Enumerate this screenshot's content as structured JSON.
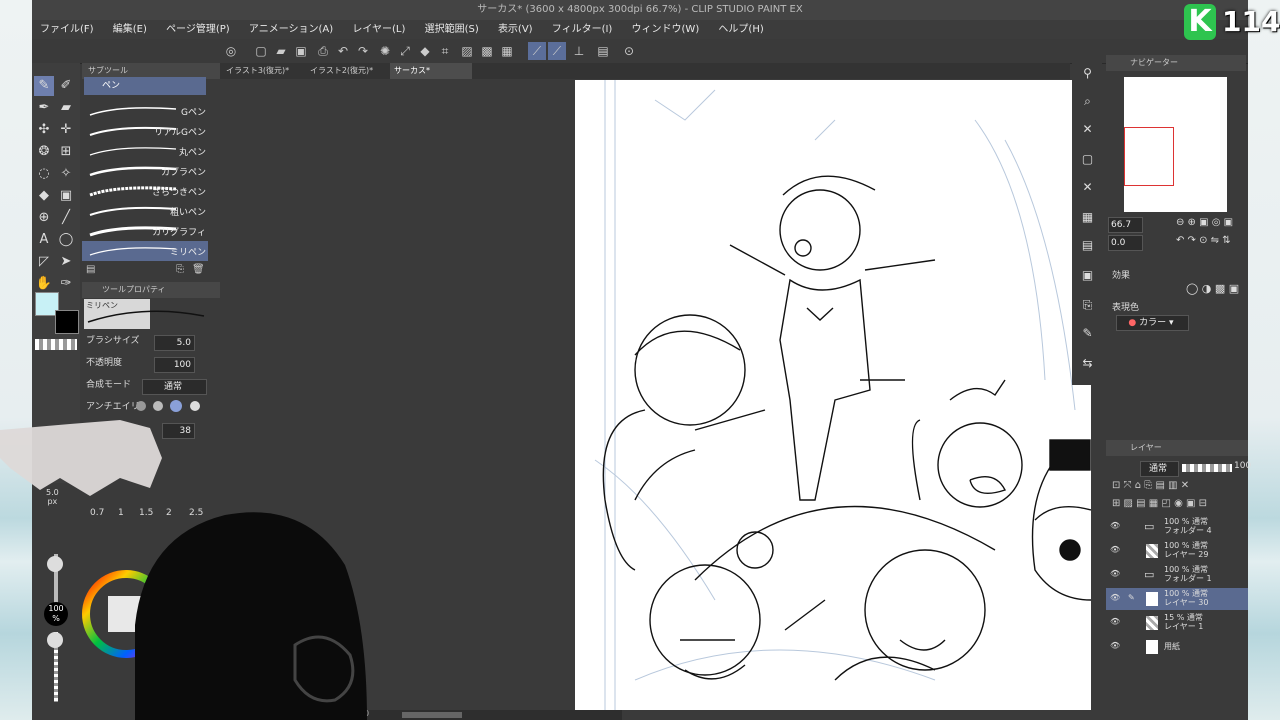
{
  "window": {
    "title": "サーカス* (3600 x 4800px 300dpi 66.7%)  - CLIP STUDIO PAINT EX"
  },
  "overlay": {
    "counter_letter": "K",
    "counter_value": "114"
  },
  "menu": [
    "ファイル(F)",
    "編集(E)",
    "ページ管理(P)",
    "アニメーション(A)",
    "レイヤー(L)",
    "選択範囲(S)",
    "表示(V)",
    "フィルター(I)",
    "ウィンドウ(W)",
    "ヘルプ(H)"
  ],
  "tabs": [
    {
      "label": "イラスト3(復元)*"
    },
    {
      "label": "イラスト2(復元)*"
    },
    {
      "label": "サーカス*"
    }
  ],
  "subtool": {
    "header": "サブツール",
    "group": "ペン",
    "brushes": [
      "Gペン",
      "リアルGペン",
      "丸ペン",
      "カブラペン",
      "ざらつきペン",
      "粗いペン",
      "カリグラフィ",
      "ミリペン"
    ]
  },
  "toolprop": {
    "header": "ツールプロパティ",
    "brush_name": "ミリペン",
    "brush_size_label": "ブラシサイズ",
    "brush_size_value": "5.0",
    "opacity_label": "不透明度",
    "opacity_value": "100",
    "blend_label": "合成モード",
    "blend_value": "通常",
    "antialias_label": "アンチエイリ",
    "extra_value": "38"
  },
  "brushsize_panel": {
    "current": "5.0",
    "unit": "px",
    "presets": [
      "0.7",
      "1",
      "1.5",
      "2",
      "2.5"
    ]
  },
  "color": {
    "main": "#c8f1f6",
    "sub": "#000000",
    "opacity_label": "100",
    "opacity_unit": "%"
  },
  "navigator": {
    "header": "ナビゲーター",
    "zoom": "66.7",
    "rotate": "0.0"
  },
  "effects": {
    "title": "効果",
    "expression_label": "表現色",
    "expression_value": "カラー"
  },
  "layers": {
    "header": "レイヤー",
    "blend": "通常",
    "opacity": "100",
    "items": [
      {
        "line1": "100 % 通常",
        "line2": "フォルダー 4",
        "kind": "folder",
        "selected": false
      },
      {
        "line1": "100 % 通常",
        "line2": "レイヤー 29",
        "kind": "raster",
        "selected": false
      },
      {
        "line1": "100 % 通常",
        "line2": "フォルダー 1",
        "kind": "folder",
        "selected": false
      },
      {
        "line1": "100 % 通常",
        "line2": "レイヤー 30",
        "kind": "raster",
        "selected": true
      },
      {
        "line1": "15 % 通常",
        "line2": "レイヤー 1",
        "kind": "raster",
        "selected": false
      },
      {
        "line1": "",
        "line2": "用紙",
        "kind": "paper",
        "selected": false
      }
    ]
  },
  "accent": "#5a6a90",
  "scroll": {
    "value": "0"
  }
}
